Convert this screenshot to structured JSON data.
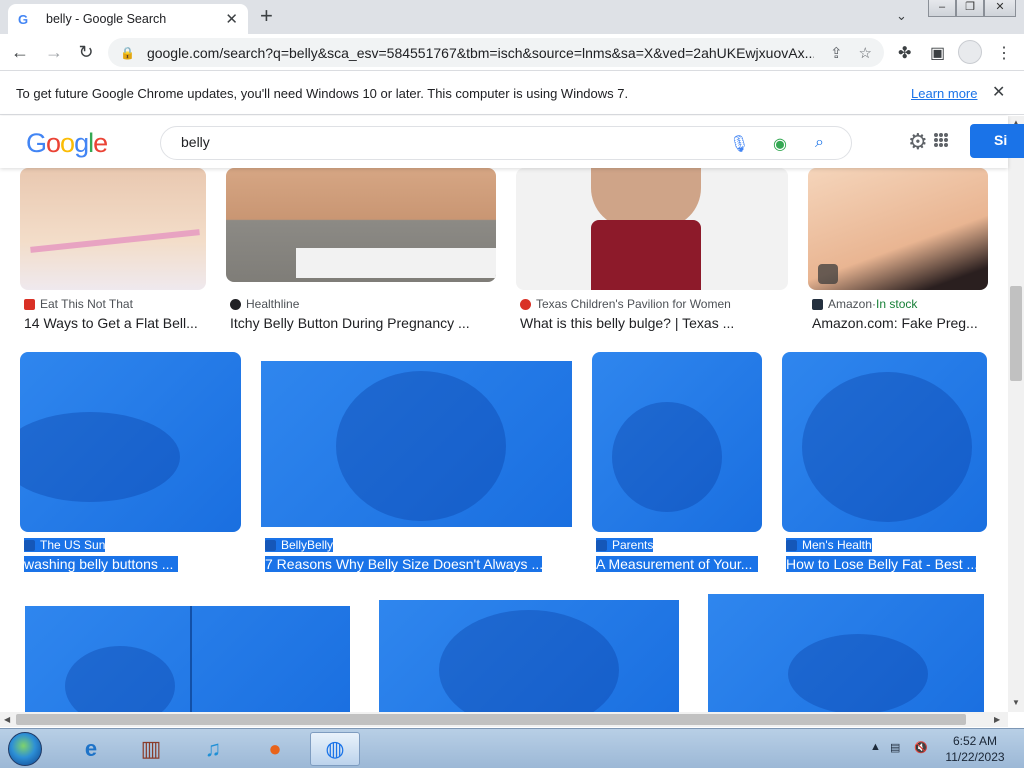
{
  "browser": {
    "tab_title": "belly - Google Search",
    "tab_favicon": "G",
    "url": "google.com/search?q=belly&sca_esv=584551767&tbm=isch&source=lnms&sa=X&ved=2ahUKEwjxuovAx..."
  },
  "infobar": {
    "message": "To get future Google Chrome updates, you'll need Windows 10 or later. This computer is using Windows 7.",
    "link": "Learn more"
  },
  "google": {
    "logo": [
      "G",
      "o",
      "o",
      "g",
      "l",
      "e"
    ],
    "logo_colors": [
      "#4285f4",
      "#ea4335",
      "#fbbc05",
      "#4285f4",
      "#34a853",
      "#ea4335"
    ],
    "query": "belly",
    "signin_label": "Si"
  },
  "row1": [
    {
      "source": "Eat This Not That",
      "caption": "14 Ways to Get a Flat Bell..."
    },
    {
      "source": "Healthline",
      "caption": "Itchy Belly Button During Pregnancy ..."
    },
    {
      "source": "Texas Children's Pavilion for Women",
      "caption": "What is this belly bulge? | Texas ..."
    },
    {
      "source": "Amazon",
      "stock": "In stock",
      "separator": " · ",
      "caption": "Amazon.com: Fake Preg..."
    }
  ],
  "row2": [
    {
      "source": "The US Sun",
      "caption": "washing belly buttons ..."
    },
    {
      "source": "BellyBelly",
      "caption": "7 Reasons Why Belly Size Doesn't Always ..."
    },
    {
      "source": "Parents",
      "caption": "A Measurement of Your..."
    },
    {
      "source": "Men's Health",
      "caption": "How to Lose Belly Fat - Best ..."
    }
  ],
  "taskbar": {
    "time": "6:52 AM",
    "date": "11/22/2023"
  },
  "colors": {
    "selection_blue": "#1a73e8",
    "link_blue": "#1a73e8",
    "stock_green": "#188038"
  }
}
